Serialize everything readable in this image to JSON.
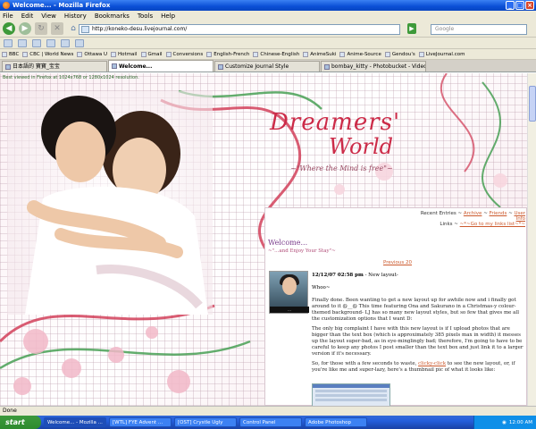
{
  "window": {
    "title": "Welcome... - Mozilla Firefox"
  },
  "menu": [
    "File",
    "Edit",
    "View",
    "History",
    "Bookmarks",
    "Tools",
    "Help"
  ],
  "nav": {
    "url": "http://koneko-desu.livejournal.com/",
    "search_placeholder": "Google"
  },
  "bookmarks": [
    "BBC",
    "CBC | World News",
    "Ottawa U",
    "Hotmail",
    "Gmail",
    "Conversions",
    "English-French",
    "Chinese-English",
    "AnimeSuki",
    "Anime-Source",
    "Gendou's",
    "LiveJournal.com"
  ],
  "tabs": [
    {
      "label": "日本語的 寶寶_宝宝"
    },
    {
      "label": "Welcome..."
    },
    {
      "label": "Customize Journal Style"
    },
    {
      "label": "bombay_kitty - Photobucket - Video a..."
    }
  ],
  "page": {
    "best_view": "Best viewed in Firefox at 1024x768 or 1280x1024 resolution.",
    "logo_line1": "Dreamers'",
    "logo_line2": "World",
    "tagline": "~\"Where the Mind is free\"~",
    "recent_label": "Recent Entries",
    "recent_links": [
      "Archive",
      "Friends",
      "User Info"
    ],
    "links_label": "Links",
    "links_text": "~*~Go to my links list~*~",
    "welcome": "Welcome...",
    "enjoy": "~\"...and Enjoy Your Stay\"~",
    "previous": "Previous 20",
    "avatar_caption": "...",
    "post_date": "12/12/07 02:58 pm",
    "post_title": "- New layout-",
    "whoo": "Whoo~",
    "para1": "Finally done. Been wanting to get a new layout up for awhile now and i finally got around to it @__@ This time featuring Ona and Sakurano in a Christmas-y colour-themed background- LJ has so many new layout styles, but so few that gives me all the customization options that I want D:",
    "para2": "The only big complaint I have with this new layout is if I upload photos that are bigger than the text box (which is approximately 385 pixels max in width) it messes up the layout super-bad, as in eye-minglingly bad; therefore, I'm going to have to be careful to keep any photos I post smaller than the text box and just link it to a larger version if it's necessary.",
    "para3_pre": "So, for those with a few seconds to waste,",
    "para3_link": "clicky-click",
    "para3_post": "to see the new layout, or, if you're like me and super-lazy, here's a thumbnail pic of what it looks like:"
  },
  "status": "Done",
  "taskbar": {
    "start": "start",
    "tasks": [
      "Welcome... - Mozilla ...",
      "[WTL] FYE Advent ...",
      "[OST] Crystle Ugly",
      "Control Panel",
      "Adobe Photoshop"
    ],
    "clock": "12:00 AM"
  },
  "colors": {
    "accent": "#cc2b48",
    "link": "#cc5a2e",
    "xp_blue": "#245edb"
  }
}
